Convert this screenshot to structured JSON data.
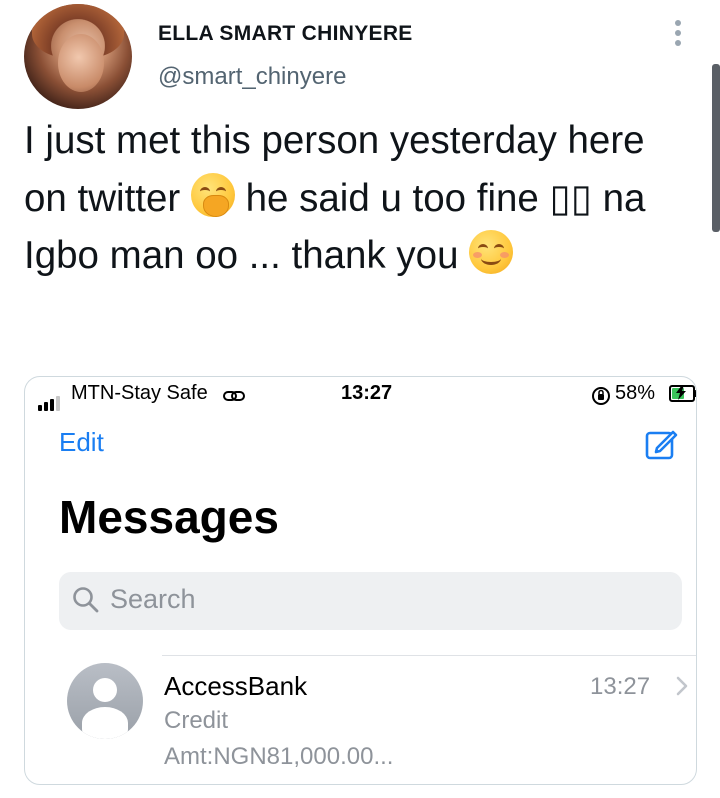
{
  "tweet": {
    "author_name": "ELLA SMART CHINYERE",
    "author_handle": "@smart_chinyere",
    "text_part1": "I just met this person yesterday here on twitter ",
    "text_part2": " he said u too fine ",
    "text_part3": " na Igbo man oo ... thank you ",
    "missing_glyphs": "▯▯",
    "emoji_1": "hand-over-mouth-emoji",
    "emoji_2": "smiling-face-emoji",
    "more_icon": "more-options-icon"
  },
  "screenshot": {
    "status_bar": {
      "carrier": "MTN-Stay Safe",
      "time": "13:27",
      "battery_percent": "58%",
      "battery_level": 0.58,
      "battery_color": "#3ac25a"
    },
    "nav": {
      "edit_label": "Edit",
      "compose_icon": "compose-icon"
    },
    "title": "Messages",
    "search": {
      "placeholder": "Search"
    },
    "messages": [
      {
        "sender": "AccessBank",
        "time": "13:27",
        "preview_line1": "Credit",
        "preview_line2": "Amt:NGN81,000.00..."
      }
    ]
  },
  "colors": {
    "ios_blue": "#1a7ef2",
    "muted_gray": "#8e939a",
    "handle_gray": "#536471"
  }
}
